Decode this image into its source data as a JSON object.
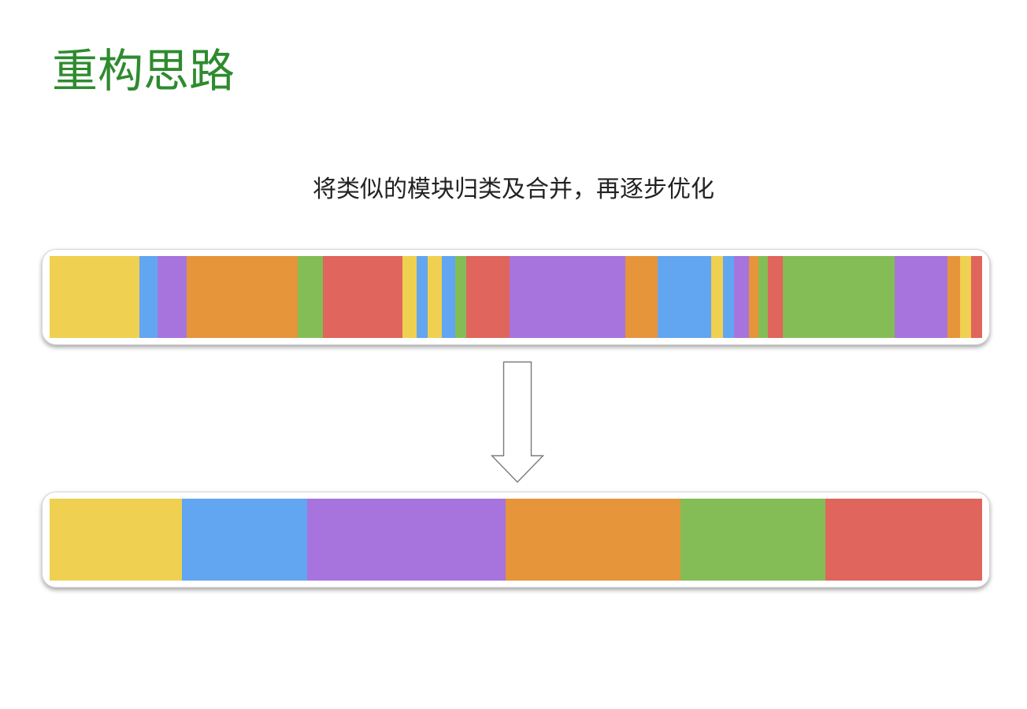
{
  "title": "重构思路",
  "subtitle": "将类似的模块归类及合并，再逐步优化",
  "colors": {
    "title": "#2e8b2e",
    "yellow": "#f0d050",
    "blue": "#62a6f2",
    "purple": "#a774dd",
    "orange": "#e6953b",
    "green": "#84bd55",
    "red": "#e0655c"
  },
  "before_bar": {
    "segments": [
      {
        "module": "yellow",
        "share": 0.0966
      },
      {
        "module": "blue",
        "share": 0.0198
      },
      {
        "module": "purple",
        "share": 0.0311
      },
      {
        "module": "orange",
        "share": 0.1197
      },
      {
        "module": "green",
        "share": 0.0277
      },
      {
        "module": "red",
        "share": 0.0853
      },
      {
        "module": "yellow",
        "share": 0.0151
      },
      {
        "module": "blue",
        "share": 0.0118
      },
      {
        "module": "yellow",
        "share": 0.016
      },
      {
        "module": "blue",
        "share": 0.0143
      },
      {
        "module": "green",
        "share": 0.0118
      },
      {
        "module": "red",
        "share": 0.047
      },
      {
        "module": "purple",
        "share": 0.1248
      },
      {
        "module": "orange",
        "share": 0.0344
      },
      {
        "module": "blue",
        "share": 0.058
      },
      {
        "module": "yellow",
        "share": 0.0126
      },
      {
        "module": "blue",
        "share": 0.0118
      },
      {
        "module": "purple",
        "share": 0.016
      },
      {
        "module": "orange",
        "share": 0.0101
      },
      {
        "module": "green",
        "share": 0.0101
      },
      {
        "module": "red",
        "share": 0.016
      },
      {
        "module": "green",
        "share": 0.1207
      },
      {
        "module": "purple",
        "share": 0.057
      },
      {
        "module": "orange",
        "share": 0.0134
      },
      {
        "module": "yellow",
        "share": 0.0126
      },
      {
        "module": "red",
        "share": 0.0113
      }
    ]
  },
  "after_bar": {
    "segments": [
      {
        "module": "yellow",
        "share": 0.1419
      },
      {
        "module": "blue",
        "share": 0.1343
      },
      {
        "module": "purple",
        "share": 0.2128
      },
      {
        "module": "orange",
        "share": 0.1875
      },
      {
        "module": "green",
        "share": 0.1554
      },
      {
        "module": "red",
        "share": 0.1681
      }
    ]
  },
  "arrow": {
    "direction": "down"
  }
}
